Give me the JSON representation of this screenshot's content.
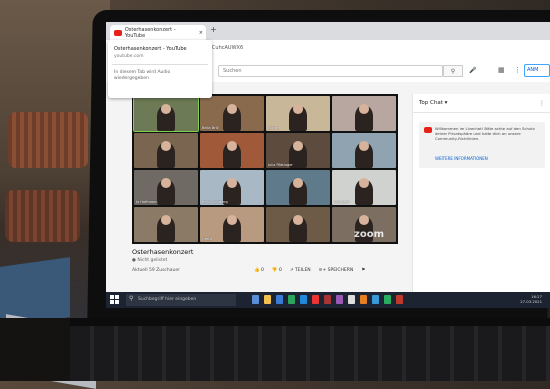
{
  "browser": {
    "tab_title": "Osterhasenkonzert - YouTube",
    "tab_close": "×",
    "new_tab": "+",
    "url": "3cCuhcAUWX6",
    "popup": {
      "title": "Osterhasenkonzert - YouTube",
      "domain": "youtube.com",
      "note": "In diesem Tab wird Audio wiedergegeben"
    }
  },
  "youtube": {
    "search_placeholder": "Suchen",
    "search_icon": "search-icon",
    "signin_label": "ANM",
    "video_title": "Osterhasenkonzert",
    "live_label": "● Nicht gelistet",
    "viewers": "Aktuell 59 Zuschauer",
    "actions": {
      "like": "👍 0",
      "dislike": "👎 0",
      "share": "↗ TEILEN",
      "save": "≡+ SPEICHERN",
      "flag": "⚑"
    }
  },
  "zoom_tiles": [
    {
      "name": "",
      "bg": "#6c7a55"
    },
    {
      "name": "Bella Brill",
      "bg": "#8a6a4c"
    },
    {
      "name": "Ebrite",
      "bg": "#c9b79a"
    },
    {
      "name": "",
      "bg": "#b8a7a0"
    },
    {
      "name": "",
      "bg": "#7a6650"
    },
    {
      "name": "",
      "bg": "#a05a3a"
    },
    {
      "name": "Julia Pöstinger",
      "bg": "#5d4b3e"
    },
    {
      "name": "",
      "bg": "#8fa3b0"
    },
    {
      "name": "Jo Hoffmann",
      "bg": "#6f6a63"
    },
    {
      "name": "Bella Goldberg",
      "bg": "#a8b8c5"
    },
    {
      "name": "",
      "bg": "#5f7a8a"
    },
    {
      "name": "Lias Leni",
      "bg": "#d0d2cf"
    },
    {
      "name": "",
      "bg": "#8a7a66"
    },
    {
      "name": "Greta",
      "bg": "#b79a80"
    },
    {
      "name": "",
      "bg": "#6d5a47"
    },
    {
      "name": "",
      "bg": "#7d6e62"
    }
  ],
  "zoom_logo": "zoom",
  "chat": {
    "header": "Top Chat ▾",
    "more": "⋮",
    "message": "Willkommen im Livechat! Bitte achte auf den Schutz deiner Privatsphäre und halte dich an unsere Community-Richtlinien.",
    "link": "WEITERE INFORMATIONEN",
    "input_placeholder": "Chat nur für Abonnenten"
  },
  "taskbar": {
    "search_placeholder": "Suchbegriff hier eingeben",
    "clock_time": "16:27",
    "clock_date": "27.03.2021",
    "icons": [
      "#5a8fd8",
      "#f2c14e",
      "#3a7bd5",
      "#2aa55b",
      "#1f8ad9",
      "#e33",
      "#a33",
      "#9b59b6",
      "#ddd",
      "#e67e22",
      "#3a9ad9",
      "#27ae60",
      "#c0392b"
    ]
  }
}
